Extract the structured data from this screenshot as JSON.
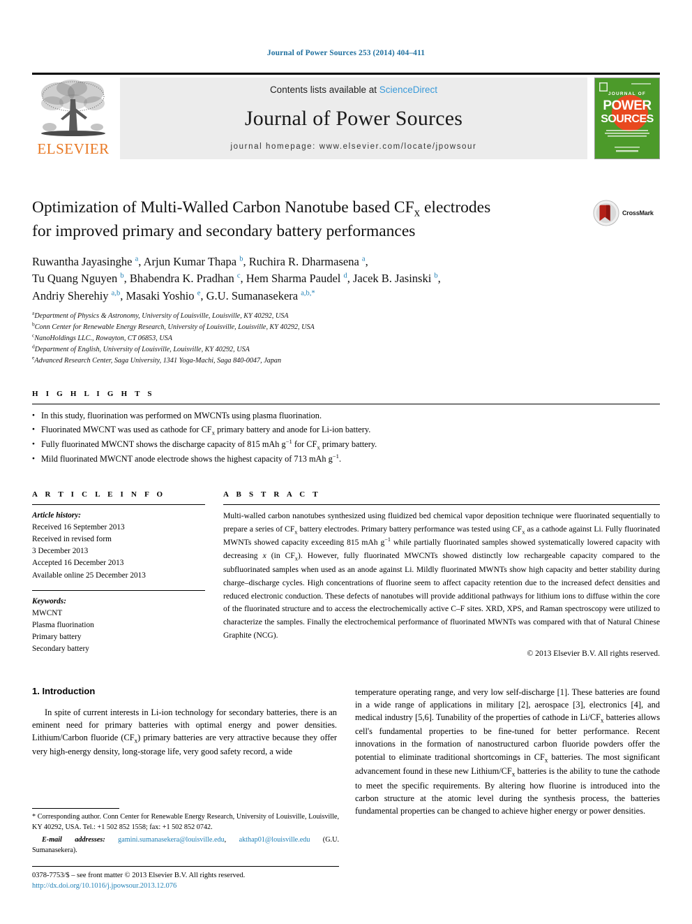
{
  "running_head": "Journal of Power Sources 253 (2014) 404–411",
  "masthead": {
    "contents_prefix": "Contents lists available at ",
    "sciencedirect": "ScienceDirect",
    "journal_title": "Journal of Power Sources",
    "homepage": "journal homepage: www.elsevier.com/locate/jpowsour",
    "elsevier_wordmark": "ELSEVIER",
    "cover_line1": "JOURNAL OF",
    "cover_line2": "POWER",
    "cover_line3": "SOURCES",
    "accent_orange": "#E87722",
    "cover_green": "#4c9a2a",
    "link_blue": "#1f7fb5"
  },
  "article": {
    "title_line1": "Optimization of Multi-Walled Carbon Nanotube based CF",
    "title_sub": "x",
    "title_line1b": " electrodes",
    "title_line2": "for improved primary and secondary battery performances",
    "crossmark_label": "CrossMark",
    "authors_line1": "Ruwantha Jayasinghe a, Arjun Kumar Thapa b, Ruchira R. Dharmasena a,",
    "authors_line2": "Tu Quang Nguyen b, Bhabendra K. Pradhan c, Hem Sharma Paudel d, Jacek B. Jasinski b,",
    "authors_line3": "Andriy Sherehiy a,b, Masaki Yoshio e, G.U. Sumanasekera a,b,*",
    "affiliations": [
      {
        "label": "a",
        "text": "Department of Physics & Astronomy, University of Louisville, Louisville, KY 40292, USA"
      },
      {
        "label": "b",
        "text": "Conn Center for Renewable Energy Research, University of Louisville, Louisville, KY 40292, USA"
      },
      {
        "label": "c",
        "text": "NanoHoldings LLC., Rowayton, CT 06853, USA"
      },
      {
        "label": "d",
        "text": "Department of English, University of Louisville, Louisville, KY 40292, USA"
      },
      {
        "label": "e",
        "text": "Advanced Research Center, Saga University, 1341 Yoga-Machi, Saga 840-0047, Japan"
      }
    ]
  },
  "highlights": {
    "heading": "H I G H L I G H T S",
    "items": [
      "In this study, fluorination was performed on MWCNTs using plasma fluorination.",
      "Fluorinated MWCNT was used as cathode for CFx primary battery and anode for Li-ion battery.",
      "Fully fluorinated MWCNT shows the discharge capacity of 815 mAh g−1 for CFx primary battery.",
      "Mild fluorinated MWCNT anode electrode shows the highest capacity of 713 mAh g−1."
    ]
  },
  "article_info": {
    "heading": "A R T I C L E   I N F O",
    "history_label": "Article history:",
    "history": [
      "Received 16 September 2013",
      "Received in revised form",
      "3 December 2013",
      "Accepted 16 December 2013",
      "Available online 25 December 2013"
    ],
    "keywords_label": "Keywords:",
    "keywords": [
      "MWCNT",
      "Plasma fluorination",
      "Primary battery",
      "Secondary battery"
    ]
  },
  "abstract": {
    "heading": "A B S T R A C T",
    "text": "Multi-walled carbon nanotubes synthesized using fluidized bed chemical vapor deposition technique were fluorinated sequentially to prepare a series of CFx battery electrodes. Primary battery performance was tested using CFx as a cathode against Li. Fully fluorinated MWNTs showed capacity exceeding 815 mAh g−1 while partially fluorinated samples showed systematically lowered capacity with decreasing x (in CFx). However, fully fluorinated MWCNTs showed distinctly low rechargeable capacity compared to the subfluorinated samples when used as an anode against Li. Mildly fluorinated MWNTs show high capacity and better stability during charge–discharge cycles. High concentrations of fluorine seem to affect capacity retention due to the increased defect densities and reduced electronic conduction. These defects of nanotubes will provide additional pathways for lithium ions to diffuse within the core of the fluorinated structure and to access the electrochemically active C–F sites. XRD, XPS, and Raman spectroscopy were utilized to characterize the samples. Finally the electrochemical performance of fluorinated MWNTs was compared with that of Natural Chinese Graphite (NCG).",
    "copyright": "© 2013 Elsevier B.V. All rights reserved."
  },
  "introduction": {
    "number_title": "1.  Introduction",
    "left_para": "In spite of current interests in Li-ion technology for secondary batteries, there is an eminent need for primary batteries with optimal energy and power densities. Lithium/Carbon fluoride (CFx) primary batteries are very attractive because they offer very high-energy density, long-storage life, very good safety record, a wide",
    "right_para": "temperature operating range, and very low self-discharge [1]. These batteries are found in a wide range of applications in military [2], aerospace [3], electronics [4], and medical industry [5,6]. Tunability of the properties of cathode in Li/CFx batteries allows cell's fundamental properties to be fine-tuned for better performance. Recent innovations in the formation of nanostructured carbon fluoride powders offer the potential to eliminate traditional shortcomings in CFx batteries. The most significant advancement found in these new Lithium/CFx batteries is the ability to tune the cathode to meet the specific requirements. By altering how fluorine is introduced into the carbon structure at the atomic level during the synthesis process, the batteries fundamental properties can be changed to achieve higher energy or power densities."
  },
  "footnotes": {
    "corresponding": "* Corresponding author. Conn Center for Renewable Energy Research, University of Louisville, Louisville, KY 40292, USA. Tel.: +1 502 852 1558; fax: +1 502 852 0742.",
    "email_label": "E-mail addresses:",
    "email1": "gamini.sumanasekera@louisville.edu",
    "email_sep": ", ",
    "email2": "akthap01@louisville.edu",
    "email_attrib": " (G.U. Sumanasekera).",
    "issn_line": "0378-7753/$ – see front matter © 2013 Elsevier B.V. All rights reserved.",
    "doi": "http://dx.doi.org/10.1016/j.jpowsour.2013.12.076"
  }
}
